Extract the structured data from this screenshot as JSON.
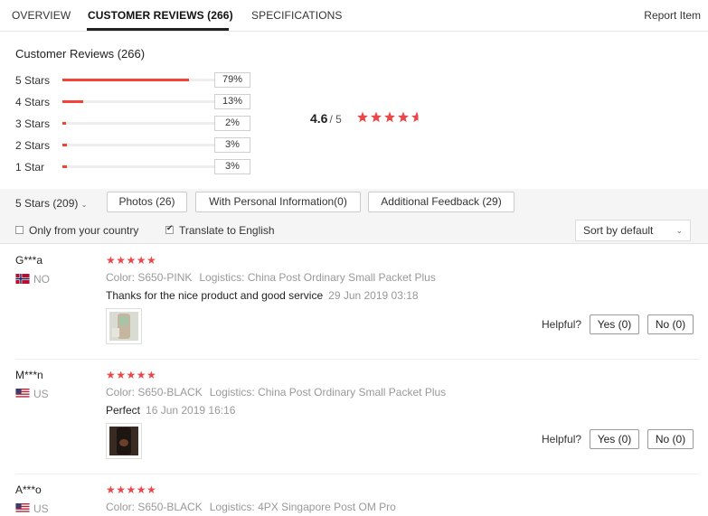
{
  "tabs": {
    "overview": "OVERVIEW",
    "reviews": "CUSTOMER REVIEWS (266)",
    "specs": "SPECIFICATIONS",
    "report": "Report Item"
  },
  "summary": {
    "title": "Customer Reviews (266)",
    "rows": [
      {
        "label": "5 Stars",
        "pct": "79%",
        "fill": 0.79
      },
      {
        "label": "4 Stars",
        "pct": "13%",
        "fill": 0.13
      },
      {
        "label": "3 Stars",
        "pct": "2%",
        "fill": 0.02
      },
      {
        "label": "2 Stars",
        "pct": "3%",
        "fill": 0.03
      },
      {
        "label": "1 Star",
        "pct": "3%",
        "fill": 0.03
      }
    ],
    "average": "4.6",
    "out_of": "/ 5",
    "average_stars": 4.6
  },
  "filters": {
    "star_select": "5 Stars (209)",
    "photos": "Photos (26)",
    "personal": "With Personal Information(0)",
    "additional": "Additional Feedback (29)",
    "only_country": "Only from your country",
    "only_country_checked": false,
    "translate": "Translate to English",
    "translate_checked": true,
    "sort": "Sort by default"
  },
  "reviews": [
    {
      "name": "G***a",
      "country": "NO",
      "stars": "★★★★★",
      "color": "Color: S650-PINK",
      "logistics": "Logistics: China Post Ordinary Small Packet Plus",
      "comment": "Thanks for the nice product and good service",
      "date": "29 Jun 2019 03:18",
      "helpful": "Helpful?",
      "yes": "Yes (0)",
      "no": "No (0)"
    },
    {
      "name": "M***n",
      "country": "US",
      "stars": "★★★★★",
      "color": "Color: S650-BLACK",
      "logistics": "Logistics: China Post Ordinary Small Packet Plus",
      "comment": "Perfect",
      "date": "16 Jun 2019 16:16",
      "helpful": "Helpful?",
      "yes": "Yes (0)",
      "no": "No (0)"
    },
    {
      "name": "A***o",
      "country": "US",
      "stars": "★★★★★",
      "color": "Color: S650-BLACK",
      "logistics": "Logistics: 4PX Singapore Post OM Pro"
    }
  ],
  "colors": {
    "accent": "#e8484a",
    "bar": "#f44336"
  }
}
